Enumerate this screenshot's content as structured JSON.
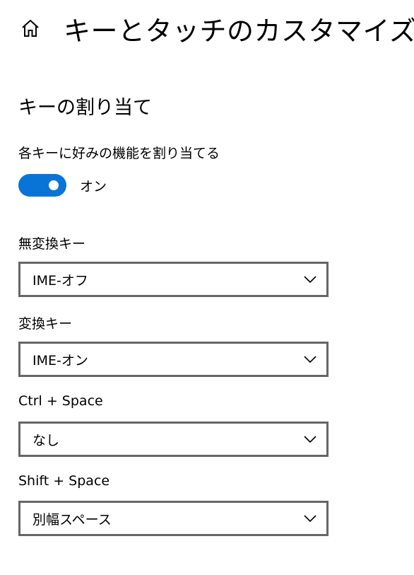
{
  "header": {
    "home_icon": "home-icon",
    "title": "キーとタッチのカスタマイズ"
  },
  "key_assignment": {
    "section_title": "キーの割り当て",
    "toggle_label": "各キーに好みの機能を割り当てる",
    "toggle_state": "オン",
    "toggle_on": true,
    "accent_color": "#0a74d6"
  },
  "settings": [
    {
      "label": "無変換キー",
      "value": "IME-オフ"
    },
    {
      "label": "変換キー",
      "value": "IME-オン"
    },
    {
      "label": "Ctrl + Space",
      "value": "なし"
    },
    {
      "label": "Shift + Space",
      "value": "別幅スペース"
    }
  ]
}
